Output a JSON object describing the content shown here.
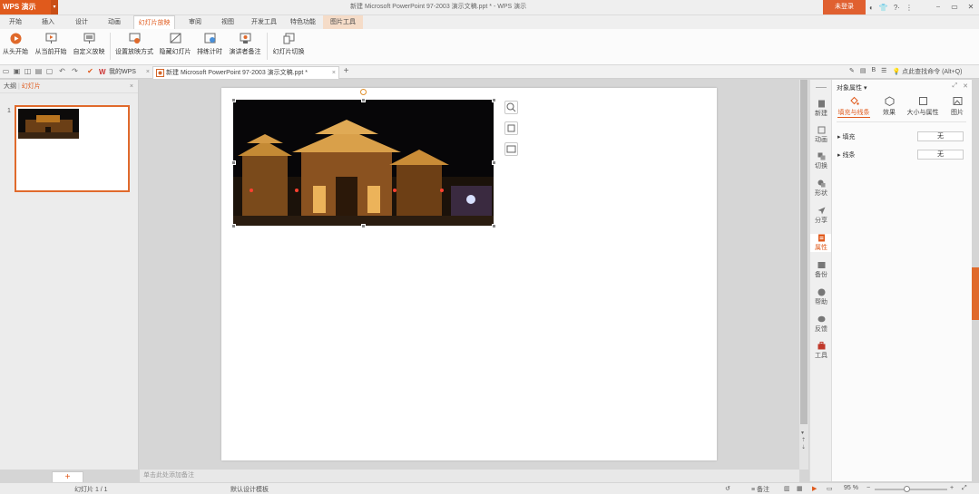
{
  "titlebar": {
    "app": "WPS 演示",
    "dropdown": "▾",
    "doc_title": "新建 Microsoft PowerPoint 97-2003 演示文稿.ppt * - WPS 演示",
    "login": "未登录",
    "icons": [
      "skin-icon",
      "shirt-icon",
      "help-icon",
      "more-icon"
    ],
    "help_label": "?·",
    "controls": [
      "⎯",
      "▭",
      "✕"
    ]
  },
  "menu": {
    "tabs": [
      "开始",
      "插入",
      "设计",
      "动画",
      "幻灯片放映",
      "审阅",
      "视图",
      "开发工具",
      "特色功能",
      "图片工具"
    ],
    "active_index": 4
  },
  "ribbon": {
    "buttons": [
      "从头开始",
      "从当前开始",
      "自定义放映",
      "设置放映方式",
      "隐藏幻灯片",
      "排练计时",
      "演讲者备注",
      "幻灯片切换"
    ]
  },
  "docbar": {
    "tabs": [
      {
        "label": "我的WPS",
        "close": "×"
      },
      {
        "label": "新建 Microsoft PowerPoint 97-2003 演示文稿.ppt *",
        "close": "×"
      }
    ],
    "add": "+",
    "find_cmd": "点此查找命令 (Alt+Q)"
  },
  "leftpane": {
    "tab_outline": "大纲",
    "tab_slides": "幻灯片",
    "close": "×",
    "slide_number": "1",
    "add": "+"
  },
  "notes": {
    "placeholder": "单击此处添加备注"
  },
  "rightbar": {
    "items": [
      "新建",
      "动画",
      "切换",
      "形状",
      "分享",
      "属性",
      "备份",
      "帮助",
      "反馈",
      "工具"
    ],
    "active_index": 5
  },
  "props": {
    "title": "对象属性 ▾",
    "tabs": [
      "填充与线条",
      "效果",
      "大小与属性",
      "图片"
    ],
    "rows": [
      {
        "label": "填充",
        "value": "无"
      },
      {
        "label": "线条",
        "value": "无"
      }
    ]
  },
  "status": {
    "slide": "幻灯片 1 / 1",
    "template": "默认设计模板",
    "notes_label": "备注",
    "zoom": "95 %",
    "minus": "−",
    "plus": "+"
  },
  "colors": {
    "accent": "#e05a1c",
    "selection_border": "#e06a2c"
  }
}
